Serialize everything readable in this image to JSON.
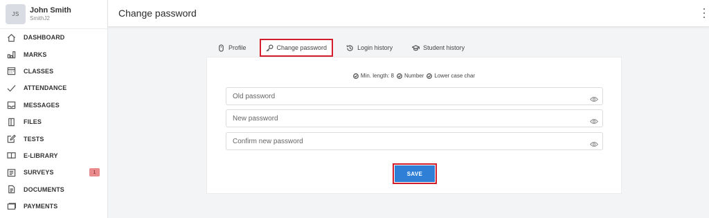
{
  "user": {
    "initials": "JS",
    "name": "John Smith",
    "login": "SmithJ2"
  },
  "sidebar": {
    "items": [
      {
        "label": "DASHBOARD",
        "icon": "home-icon"
      },
      {
        "label": "MARKS",
        "icon": "bar-chart-icon"
      },
      {
        "label": "CLASSES",
        "icon": "calendar-icon"
      },
      {
        "label": "ATTENDANCE",
        "icon": "check-icon"
      },
      {
        "label": "MESSAGES",
        "icon": "inbox-icon"
      },
      {
        "label": "FILES",
        "icon": "file-icon"
      },
      {
        "label": "TESTS",
        "icon": "edit-icon"
      },
      {
        "label": "E-LIBRARY",
        "icon": "book-icon"
      },
      {
        "label": "SURVEYS",
        "icon": "list-icon",
        "badge": "1"
      },
      {
        "label": "DOCUMENTS",
        "icon": "document-icon"
      },
      {
        "label": "PAYMENTS",
        "icon": "wallet-icon"
      }
    ]
  },
  "header": {
    "title": "Change password"
  },
  "tabs": [
    {
      "label": "Profile",
      "icon": "mouse-icon"
    },
    {
      "label": "Change password",
      "icon": "key-icon",
      "active": true
    },
    {
      "label": "Login history",
      "icon": "history-icon"
    },
    {
      "label": "Student history",
      "icon": "graduation-cap-icon"
    }
  ],
  "rules": [
    "Min. length: 8",
    "Number",
    "Lower case char"
  ],
  "fields": {
    "old_placeholder": "Old password",
    "new_placeholder": "New password",
    "confirm_placeholder": "Confirm new password"
  },
  "save_label": "SAVE",
  "colors": {
    "accent": "#2f7fd7",
    "highlight": "#d21d2b",
    "badge": "#e98a8c"
  }
}
